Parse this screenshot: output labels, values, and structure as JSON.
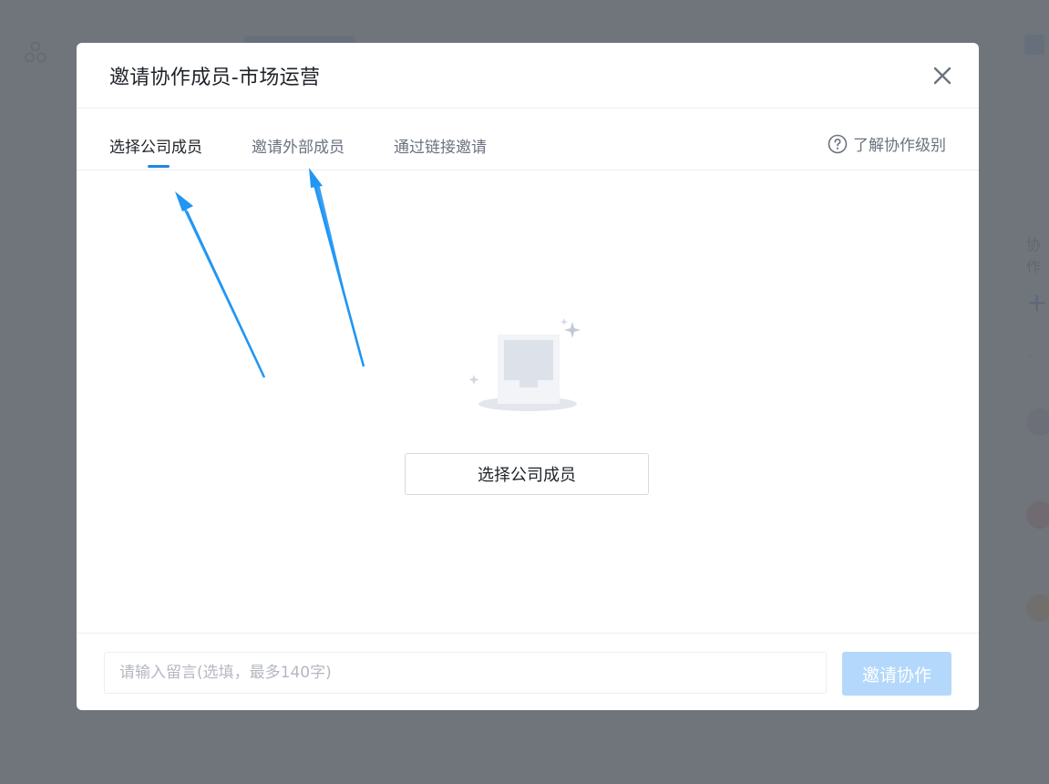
{
  "modal": {
    "title": "邀请协作成员-市场运营"
  },
  "tabs": [
    {
      "label": "选择公司成员",
      "active": true
    },
    {
      "label": "邀请外部成员",
      "active": false
    },
    {
      "label": "通过链接邀请",
      "active": false
    }
  ],
  "help": {
    "label": "了解协作级别",
    "icon": "question-circle-icon"
  },
  "body": {
    "select_button_label": "选择公司成员",
    "illustration": "empty-folder-icon"
  },
  "footer": {
    "message_placeholder": "请输入留言(选填，最多140字)",
    "message_value": "",
    "invite_button_label": "邀请协作"
  },
  "background": {
    "side_text": "协作"
  },
  "colors": {
    "accent": "#1e88e5",
    "annotation_arrow": "#2196f3",
    "invite_disabled": "#b3d8fb",
    "overlay": "#5f626a"
  }
}
